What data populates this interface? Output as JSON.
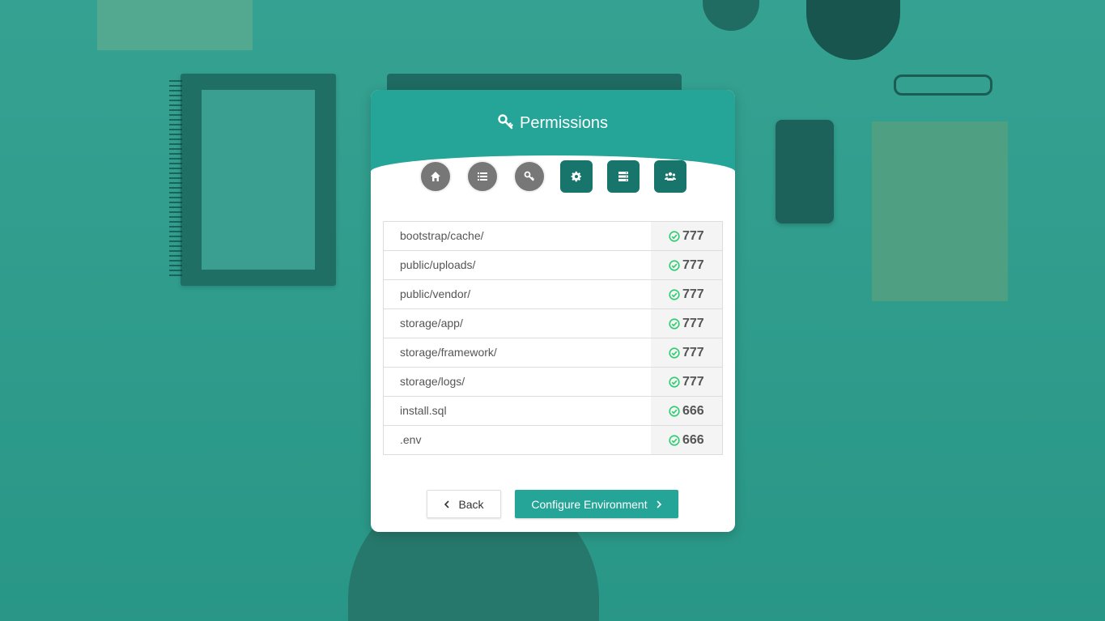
{
  "header": {
    "title": "Permissions",
    "title_icon": "key-icon"
  },
  "steps": [
    {
      "name": "home",
      "icon": "home-icon",
      "state": "done"
    },
    {
      "name": "requirements",
      "icon": "list-icon",
      "state": "done"
    },
    {
      "name": "permissions",
      "icon": "key-icon",
      "state": "done"
    },
    {
      "name": "settings",
      "icon": "gear-icon",
      "state": "todo"
    },
    {
      "name": "database",
      "icon": "server-icon",
      "state": "todo"
    },
    {
      "name": "users",
      "icon": "users-icon",
      "state": "todo"
    }
  ],
  "permissions": [
    {
      "path": "bootstrap/cache/",
      "value": "777"
    },
    {
      "path": "public/uploads/",
      "value": "777"
    },
    {
      "path": "public/vendor/",
      "value": "777"
    },
    {
      "path": "storage/app/",
      "value": "777"
    },
    {
      "path": "storage/framework/",
      "value": "777"
    },
    {
      "path": "storage/logs/",
      "value": "777"
    },
    {
      "path": "install.sql",
      "value": "666"
    },
    {
      "path": ".env",
      "value": "666"
    }
  ],
  "buttons": {
    "back_label": "Back",
    "next_label": "Configure Environment"
  },
  "colors": {
    "accent": "#25a597",
    "step_done": "#777777",
    "step_todo": "#17756b",
    "ok": "#2ecc71"
  }
}
